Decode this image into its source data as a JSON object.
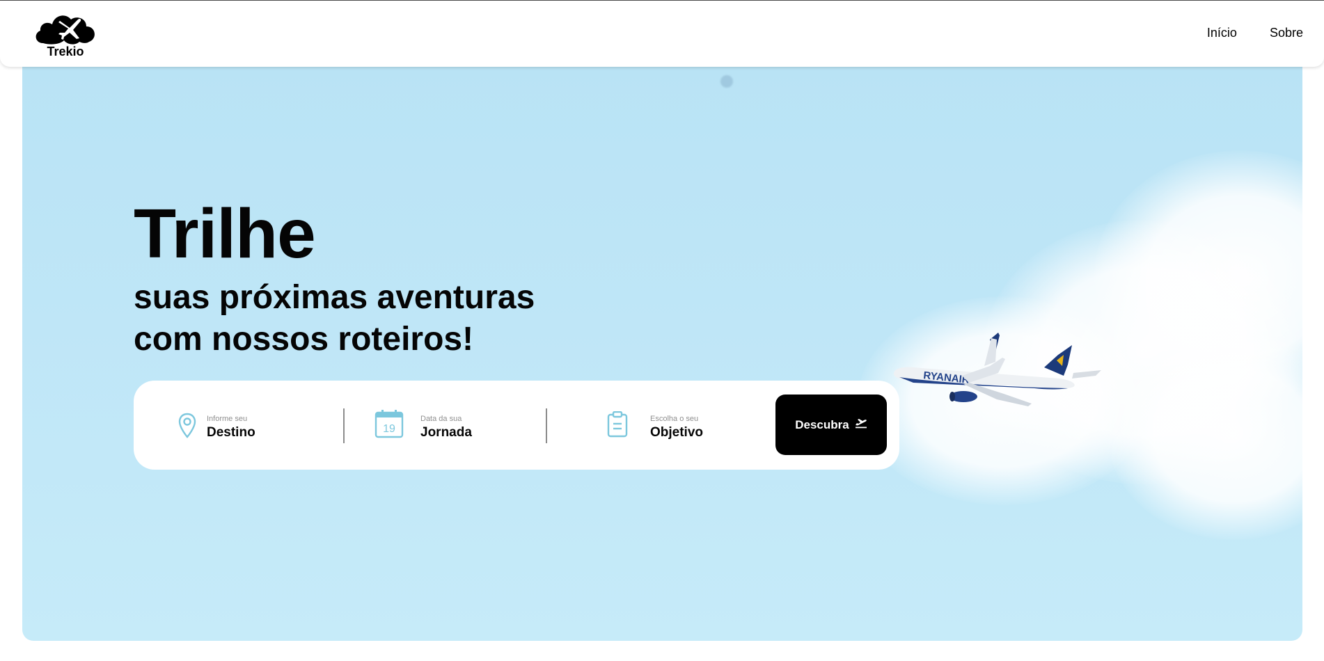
{
  "header": {
    "brand": "Trekio",
    "nav": [
      {
        "label": "Início"
      },
      {
        "label": "Sobre"
      }
    ]
  },
  "hero": {
    "title": "Trilhe",
    "subtitle_line1": "suas próximas aventuras",
    "subtitle_line2": "com nossos roteiros!",
    "search": {
      "destination": {
        "hint": "Informe seu",
        "label": "Destino",
        "icon": "map-pin-icon"
      },
      "date": {
        "hint": "Data da sua",
        "label": "Jornada",
        "icon": "calendar-icon",
        "day": "19"
      },
      "goal": {
        "hint": "Escolha o seu",
        "label": "Objetivo",
        "icon": "clipboard-icon"
      },
      "button": {
        "label": "Descubra",
        "icon": "plane-takeoff-icon"
      }
    }
  },
  "colors": {
    "sky": "#bfe6f7",
    "icon_accent": "#7cc7dd",
    "button_bg": "#000000",
    "text": "#050505"
  }
}
